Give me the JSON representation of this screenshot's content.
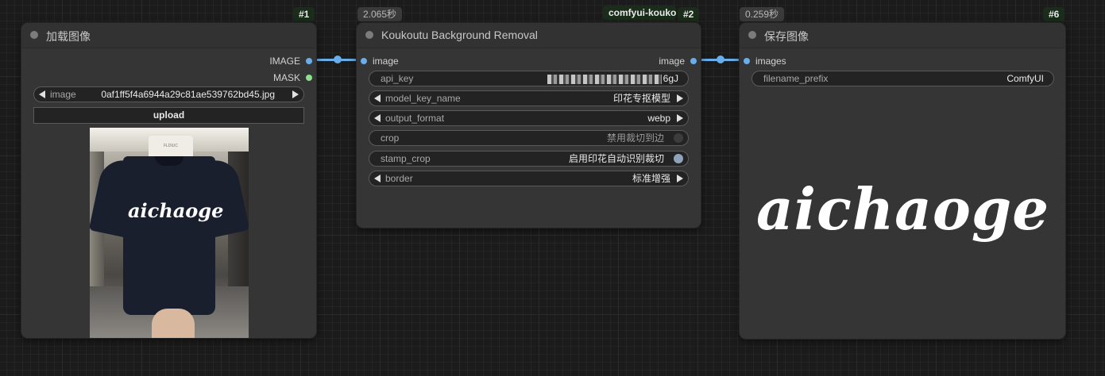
{
  "wires_color": "#67aeea",
  "node1": {
    "id_badge": "#1",
    "title": "加载图像",
    "outputs": [
      {
        "label": "IMAGE",
        "color": "#67aeea"
      },
      {
        "label": "MASK",
        "color": "#8ee08e"
      }
    ],
    "image_widget": {
      "name": "image",
      "value": "0af1ff5f4a6944a29c81ae539762bd45.jpg"
    },
    "upload_label": "upload",
    "preview": {
      "shirt_text": "aichaoge",
      "hanger_text": "FLDIUC"
    }
  },
  "node2": {
    "time_badge": "2.065秒",
    "package_badge": "comfyui-kouko",
    "id_badge": "#2",
    "title": "Koukoutu Background Removal",
    "input": {
      "label": "image",
      "color": "#67aeea"
    },
    "output": {
      "label": "image",
      "color": "#67aeea"
    },
    "widgets": [
      {
        "name": "api_key",
        "value": "6gJ",
        "type": "text"
      },
      {
        "name": "model_key_name",
        "value": "印花专抠模型",
        "type": "combo"
      },
      {
        "name": "output_format",
        "value": "webp",
        "type": "combo"
      },
      {
        "name": "crop",
        "value": "禁用裁切到边",
        "type": "toggle",
        "on": false
      },
      {
        "name": "stamp_crop",
        "value": "启用印花自动识别裁切",
        "type": "toggle",
        "on": true
      },
      {
        "name": "border",
        "value": "标准增强",
        "type": "combo"
      }
    ]
  },
  "node6": {
    "time_badge": "0.259秒",
    "id_badge": "#6",
    "title": "保存图像",
    "input": {
      "label": "images",
      "color": "#67aeea"
    },
    "widget": {
      "name": "filename_prefix",
      "value": "ComfyUI"
    },
    "preview_text": "aichaoge"
  }
}
